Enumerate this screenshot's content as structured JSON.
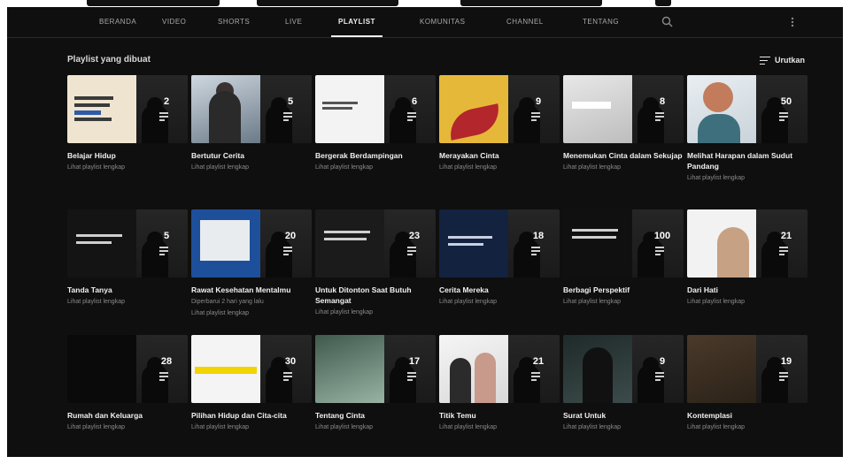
{
  "tabs": [
    {
      "label": "BERANDA",
      "active": false
    },
    {
      "label": "VIDEO",
      "active": false
    },
    {
      "label": "SHORTS",
      "active": false
    },
    {
      "label": "LIVE",
      "active": false
    },
    {
      "label": "PLAYLIST",
      "active": true
    },
    {
      "label": "KOMUNITAS",
      "active": false
    },
    {
      "label": "CHANNEL",
      "active": false
    },
    {
      "label": "TENTANG",
      "active": false
    }
  ],
  "section": {
    "title": "Playlist yang dibuat",
    "sort_label": "Urutkan"
  },
  "playlists": [
    {
      "title": "Belajar Hidup",
      "count": "2",
      "link": "Lihat playlist lengkap"
    },
    {
      "title": "Bertutur Cerita",
      "count": "5",
      "link": "Lihat playlist lengkap"
    },
    {
      "title": "Bergerak Berdampingan",
      "count": "6",
      "link": "Lihat playlist lengkap"
    },
    {
      "title": "Merayakan Cinta",
      "count": "9",
      "link": "Lihat playlist lengkap"
    },
    {
      "title": "Menemukan Cinta dalam Sekujap",
      "count": "8",
      "link": "Lihat playlist lengkap"
    },
    {
      "title": "Melihat Harapan dalam Sudut Pandang",
      "count": "50",
      "link": "Lihat playlist lengkap"
    },
    {
      "title": "Tanda Tanya",
      "count": "5",
      "link": "Lihat playlist lengkap"
    },
    {
      "title": "Rawat Kesehatan Mentalmu",
      "count": "20",
      "subtitle": "Diperbarui 2 hari yang lalu",
      "link": "Lihat playlist lengkap"
    },
    {
      "title": "Untuk Ditonton Saat Butuh Semangat",
      "count": "23",
      "link": "Lihat playlist lengkap"
    },
    {
      "title": "Cerita Mereka",
      "count": "18",
      "link": "Lihat playlist lengkap"
    },
    {
      "title": "Berbagi Perspektif",
      "count": "100",
      "link": "Lihat playlist lengkap"
    },
    {
      "title": "Dari Hati",
      "count": "21",
      "link": "Lihat playlist lengkap"
    },
    {
      "title": "Rumah dan Keluarga",
      "count": "28",
      "link": "Lihat playlist lengkap"
    },
    {
      "title": "Pilihan Hidup dan Cita-cita",
      "count": "30",
      "link": "Lihat playlist lengkap"
    },
    {
      "title": "Tentang Cinta",
      "count": "17",
      "link": "Lihat playlist lengkap"
    },
    {
      "title": "Titik Temu",
      "count": "21",
      "link": "Lihat playlist lengkap"
    },
    {
      "title": "Surat Untuk",
      "count": "9",
      "link": "Lihat playlist lengkap"
    },
    {
      "title": "Kontemplasi",
      "count": "19",
      "link": "Lihat playlist lengkap"
    }
  ],
  "icons": {
    "search": "search-icon",
    "more": "more-vert-icon",
    "sort": "sort-icon",
    "playlist": "playlist-icon"
  },
  "colors": {
    "background": "#0f0f0f",
    "text_primary": "#f1f1f1",
    "text_secondary": "#8a8a8a"
  }
}
